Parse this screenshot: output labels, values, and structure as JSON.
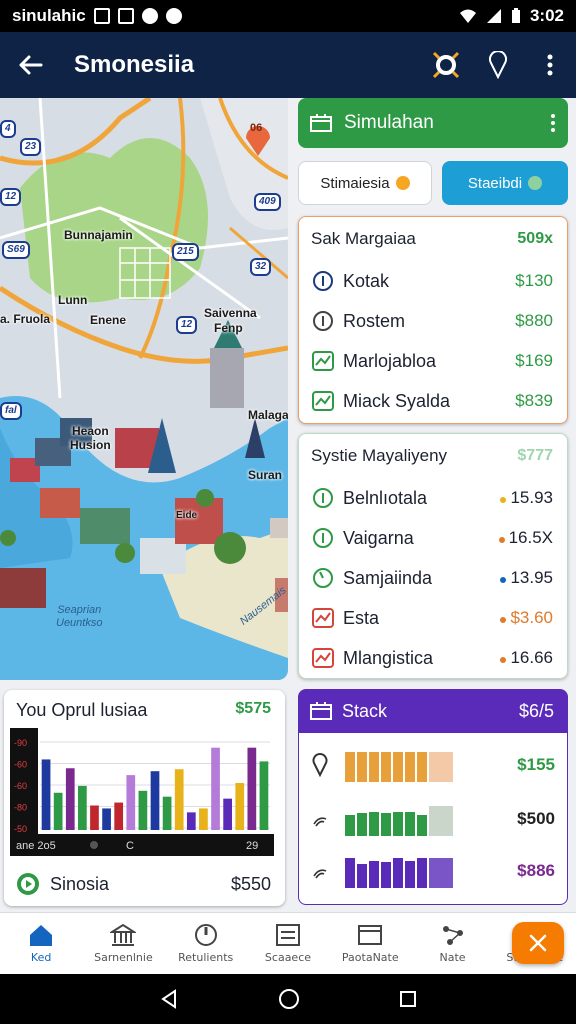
{
  "status_bar": {
    "app_name": "sinulahic",
    "time": "3:02"
  },
  "app_bar": {
    "title": "Smonesiia"
  },
  "map": {
    "labels": {
      "district": "Bunnajamin",
      "lunn": "Lunn",
      "fruola": "a. Fruola",
      "enene": "Enene",
      "saivenna": "Saivenna",
      "fenp": "Fenp",
      "malaga": "Malaga",
      "heaon": "Heaon",
      "husion": "Husion",
      "suran": "Suran",
      "small": "Eide",
      "water_1": "Seaprian",
      "water_2": "Ueuntkso",
      "water_shore": "Nausemais"
    },
    "shields": [
      "23",
      "4",
      "12",
      "409",
      "S69",
      "215",
      "12",
      "fal",
      "32"
    ],
    "pin_label": "06"
  },
  "sim_header": {
    "title": "Simulahan"
  },
  "pills": {
    "left": "Stimaiesia",
    "right": "Staeibdi"
  },
  "card_one": {
    "title": "Sak Margaiaa",
    "value": "509x",
    "rows": [
      {
        "label": "Kotak",
        "value": "$130",
        "icon": "info-circle-icon"
      },
      {
        "label": "Rostem",
        "value": "$880",
        "icon": "info-circle-icon"
      },
      {
        "label": "Marlojabloa",
        "value": "$169",
        "icon": "chart-badge-icon"
      },
      {
        "label": "Miack Syalda",
        "value": "$839",
        "icon": "chart-badge-icon"
      }
    ]
  },
  "card_two": {
    "title": "Systie Mayaliyeny",
    "value": "$777",
    "rows": [
      {
        "label": "Belnlıotala",
        "value": "15.93",
        "dot": "#e8b21a"
      },
      {
        "label": "Vaigarna",
        "value": "16.5X",
        "dot": "#e07b2c"
      },
      {
        "label": "Samjaiinda",
        "value": "13.95",
        "dot": "#1565c0"
      },
      {
        "label": "Esta",
        "value": "$3.60",
        "dot": "#e07b2c"
      },
      {
        "label": "Mlangistica",
        "value": "16.66",
        "dot": "#e07b2c"
      }
    ]
  },
  "chart_card": {
    "title": "You Oprul lusiaa",
    "value": "$575",
    "footer_label": "Sinosia",
    "footer_value": "$550"
  },
  "chart_data": {
    "type": "bar",
    "title": "",
    "y_tick_labels": [
      "90",
      "60",
      "60",
      "80",
      "50"
    ],
    "x_tick_labels": [
      "ane 2o5",
      "C",
      "29"
    ],
    "values": [
      72,
      38,
      63,
      45,
      25,
      22,
      28,
      56,
      40,
      60,
      34,
      62,
      18,
      22,
      84,
      32,
      48,
      84,
      70
    ],
    "bar_colors": [
      "#1e3a9e",
      "#2f9a46",
      "#7a2a8f",
      "#2f9a46",
      "#c0272d",
      "#1e3a9e",
      "#c0272d",
      "#b57bd9",
      "#2f9a46",
      "#1e3a9e",
      "#2f9a46",
      "#e8b21a",
      "#5a2bb8",
      "#e8b21a",
      "#b57bd9",
      "#5a2bb8",
      "#e8b21a",
      "#7a2a8f",
      "#2f9a46"
    ],
    "ylim": [
      0,
      100
    ],
    "grid": true
  },
  "stack_card": {
    "title": "Stack",
    "value": "$6/5",
    "rows": [
      {
        "value": "$155",
        "color": "#e8a13a",
        "fade": "#f3c9a8",
        "value_color": "#2f9a46",
        "icon": "location-pin-icon",
        "fills": [
          100,
          100,
          100,
          100,
          100,
          100,
          100
        ]
      },
      {
        "value": "$500",
        "color": "#2f9a46",
        "fade": "#c9d6c9",
        "value_color": "#222222",
        "icon": "signal-icon",
        "fills": [
          70,
          75,
          80,
          75,
          80,
          80,
          70
        ]
      },
      {
        "value": "$886",
        "color": "#5a2bb8",
        "fade": "#7a55c8",
        "value_color": "#7a2a8f",
        "icon": "signal-icon",
        "fills": [
          100,
          80,
          90,
          85,
          100,
          90,
          100
        ]
      }
    ]
  },
  "bottom_nav": [
    {
      "label": "Ked",
      "icon": "home-icon",
      "active": true
    },
    {
      "label": "Sarnenlnie",
      "icon": "bank-icon",
      "active": false
    },
    {
      "label": "Retulients",
      "icon": "compass-icon",
      "active": false
    },
    {
      "label": "Scaaece",
      "icon": "list-icon",
      "active": false
    },
    {
      "label": "PaotaNate",
      "icon": "wallet-icon",
      "active": false
    },
    {
      "label": "Nate",
      "icon": "share-icon",
      "active": false
    },
    {
      "label": "Stachstike",
      "icon": "gear-icon",
      "active": false
    }
  ]
}
